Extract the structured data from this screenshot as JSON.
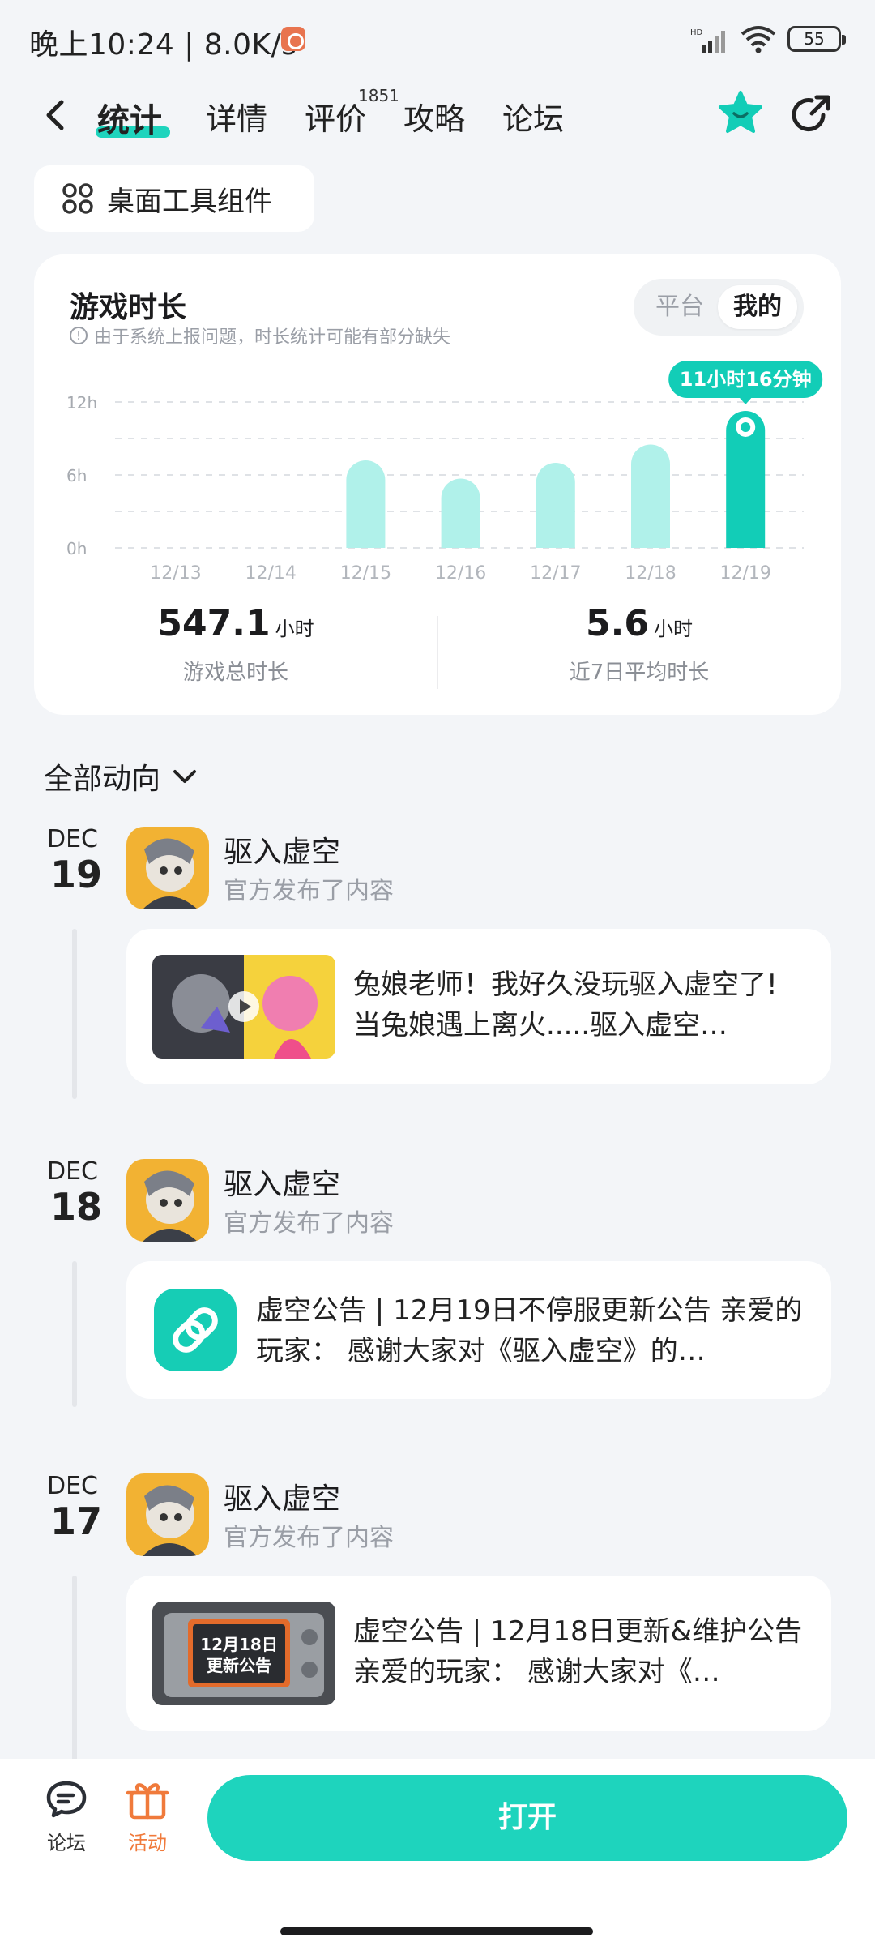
{
  "status_bar": {
    "time": "晚上10:24 | 8.0K/s",
    "battery": "55"
  },
  "nav": {
    "tabs": [
      {
        "label": "统计"
      },
      {
        "label": "详情"
      },
      {
        "label": "评价"
      },
      {
        "label": "攻略"
      },
      {
        "label": "论坛"
      }
    ],
    "review_count": "1851"
  },
  "widget_button": {
    "label": "桌面工具组件"
  },
  "stats": {
    "title": "游戏时长",
    "note": "由于系统上报问题，时长统计可能有部分缺失",
    "toggle": {
      "platform": "平台",
      "mine": "我的"
    },
    "total_value": "547.1",
    "total_unit": "小时",
    "total_label": "游戏总时长",
    "avg_value": "5.6",
    "avg_unit": "小时",
    "avg_label": "近7日平均时长"
  },
  "chart_data": {
    "type": "bar",
    "categories": [
      "12/13",
      "12/14",
      "12/15",
      "12/16",
      "12/17",
      "12/18",
      "12/19"
    ],
    "values": [
      0,
      0,
      7.2,
      5.7,
      7.0,
      8.5,
      11.27
    ],
    "yticks": [
      "0h",
      "6h",
      "12h"
    ],
    "ylim": [
      0,
      12
    ],
    "highlight_index": 6,
    "highlight_label": "11小时16分钟",
    "colors": {
      "bar": "#b0f1ea",
      "highlight": "#12cdb7"
    }
  },
  "feed": {
    "filter_label": "全部动向",
    "items": [
      {
        "month": "DEC",
        "day": "19",
        "game": "驱入虚空",
        "subtitle": "官方发布了内容",
        "post_text": "兔娘老师！我好久没玩驱入虚空了! 当兔娘遇上离火.....驱入虚空…",
        "thumb": "video"
      },
      {
        "month": "DEC",
        "day": "18",
        "game": "驱入虚空",
        "subtitle": "官方发布了内容",
        "post_text": "虚空公告 | 12月19日不停服更新公告 亲爱的玩家： 感谢大家对《驱入虚空》的…",
        "thumb": "link"
      },
      {
        "month": "DEC",
        "day": "17",
        "game": "驱入虚空",
        "subtitle": "官方发布了内容",
        "post_text": "虚空公告 | 12月18日更新&维护公告 亲爱的玩家： 感谢大家对《…",
        "thumb": "notice",
        "thumb_text_1": "12月18日",
        "thumb_text_2": "更新公告"
      }
    ]
  },
  "bottom_bar": {
    "forum_label": "论坛",
    "activity_label": "活动",
    "open_label": "打开",
    "accent": "#1ed4bd",
    "activity_color": "#f07a3b"
  }
}
